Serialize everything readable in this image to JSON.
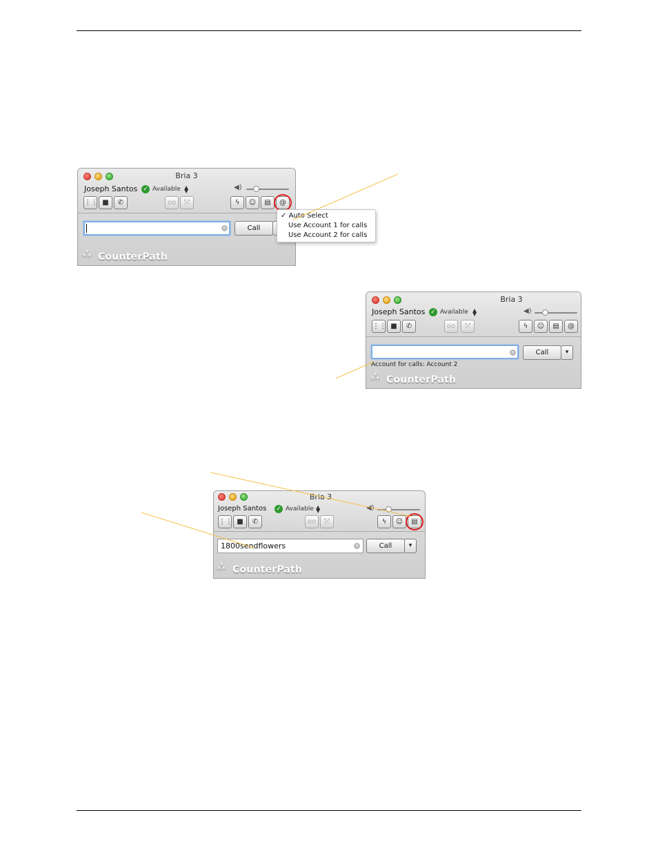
{
  "app": {
    "title": "Bria 3",
    "user": "Joseph Santos",
    "status": "Available",
    "call_label": "Call",
    "logo_text": "CounterPath"
  },
  "account_menu": {
    "items": [
      {
        "label": "Auto Select",
        "checked": true
      },
      {
        "label": "Use Account 1 for calls",
        "checked": false
      },
      {
        "label": "Use Account 2 for calls",
        "checked": false
      }
    ]
  },
  "window2": {
    "account_message": "Account for calls: Account 2"
  },
  "window3": {
    "dial_value": "1800sendflowers"
  },
  "colors": {
    "callout_line": "#f5c24a",
    "highlight_ring": "#e02020",
    "status_green": "#2f9a2f"
  },
  "icons": [
    "dialpad-icon",
    "video-icon",
    "phone-icon",
    "voicemail-icon",
    "transfer-icon",
    "flash-icon",
    "contacts-icon",
    "directory-icon",
    "at-icon",
    "volume-icon",
    "checkmark-icon",
    "clear-icon",
    "dropdown-arrow-icon",
    "counterpath-logo-icon"
  ]
}
